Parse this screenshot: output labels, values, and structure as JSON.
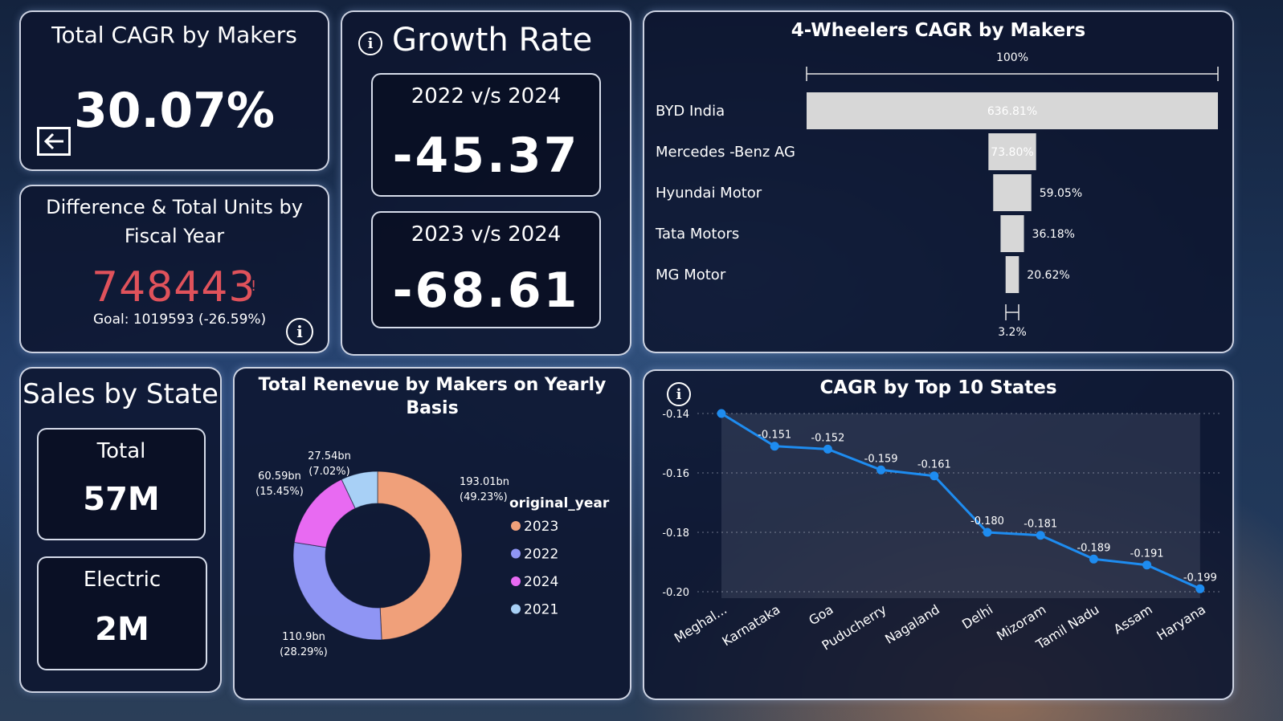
{
  "total_cagr": {
    "title": "Total CAGR by Makers",
    "value": "30.07%"
  },
  "difference": {
    "title_line1": "Difference & Total Units by",
    "title_line2": "Fiscal Year",
    "value": "748443",
    "marker": "!",
    "goal": "Goal: 1019593 (-26.59%)"
  },
  "growth_rate": {
    "title": "Growth Rate",
    "card1": {
      "label": "2022 v/s 2024",
      "value": "-45.37"
    },
    "card2": {
      "label": "2023 v/s 2024",
      "value": "-68.61"
    }
  },
  "sales_by_state": {
    "title": "Sales by State",
    "total": {
      "label": "Total",
      "value": "57M"
    },
    "electric": {
      "label": "Electric",
      "value": "2M"
    }
  },
  "funnel": {
    "title": "4-Wheelers CAGR by Makers",
    "top_label": "100%",
    "bottom_label": "3.2%"
  },
  "donut": {
    "title_line1": "Total Renevue by Makers on Yearly",
    "title_line2": "Basis",
    "legend_title": "original_year"
  },
  "line": {
    "title": "CAGR by Top 10 States"
  },
  "colors": {
    "accent_red": "#e0525b",
    "line_blue": "#1e8cf0",
    "y2023": "#f0a07a",
    "y2022": "#8f95f4",
    "y2024": "#e86af2",
    "y2021": "#a8d0f6"
  },
  "icons": [
    "back-arrow-icon",
    "info-icon"
  ],
  "chart_data": [
    {
      "type": "bar",
      "title": "4-Wheelers CAGR by Makers",
      "categories": [
        "BYD India",
        "Mercedes -Benz AG",
        "Hyundai Motor",
        "Tata Motors",
        "MG Motor"
      ],
      "values": [
        636.81,
        73.8,
        59.05,
        36.18,
        20.62
      ],
      "labels": [
        "636.81%",
        "73.80%",
        "59.05%",
        "36.18%",
        "20.62%"
      ]
    },
    {
      "type": "pie",
      "title": "Total Renevue by Makers on Yearly Basis",
      "legend": "original_year",
      "categories": [
        "2023",
        "2022",
        "2024",
        "2021"
      ],
      "values": [
        193.01,
        110.9,
        60.59,
        27.54
      ],
      "labels": [
        "193.01bn",
        "110.9bn",
        "60.59bn",
        "27.54bn"
      ],
      "percents": [
        "(49.23%)",
        "(28.29%)",
        "(15.45%)",
        "(7.02%)"
      ]
    },
    {
      "type": "line",
      "title": "CAGR by Top 10 States",
      "categories": [
        "Meghal...",
        "Karnataka",
        "Goa",
        "Puducherry",
        "Nagaland",
        "Delhi",
        "Mizoram",
        "Tamil Nadu",
        "Assam",
        "Haryana"
      ],
      "values": [
        -0.14,
        -0.151,
        -0.152,
        -0.159,
        -0.161,
        -0.18,
        -0.181,
        -0.189,
        -0.191,
        -0.199
      ],
      "labels": [
        "",
        "-0.151",
        "-0.152",
        "-0.159",
        "-0.161",
        "-0.180",
        "-0.181",
        "-0.189",
        "-0.191",
        "-0.199"
      ],
      "yticks": [
        -0.14,
        -0.16,
        -0.18,
        -0.2
      ],
      "ytick_labels": [
        "-0.14",
        "-0.16",
        "-0.18",
        "-0.20"
      ],
      "ylim": [
        -0.2,
        -0.14
      ]
    }
  ]
}
